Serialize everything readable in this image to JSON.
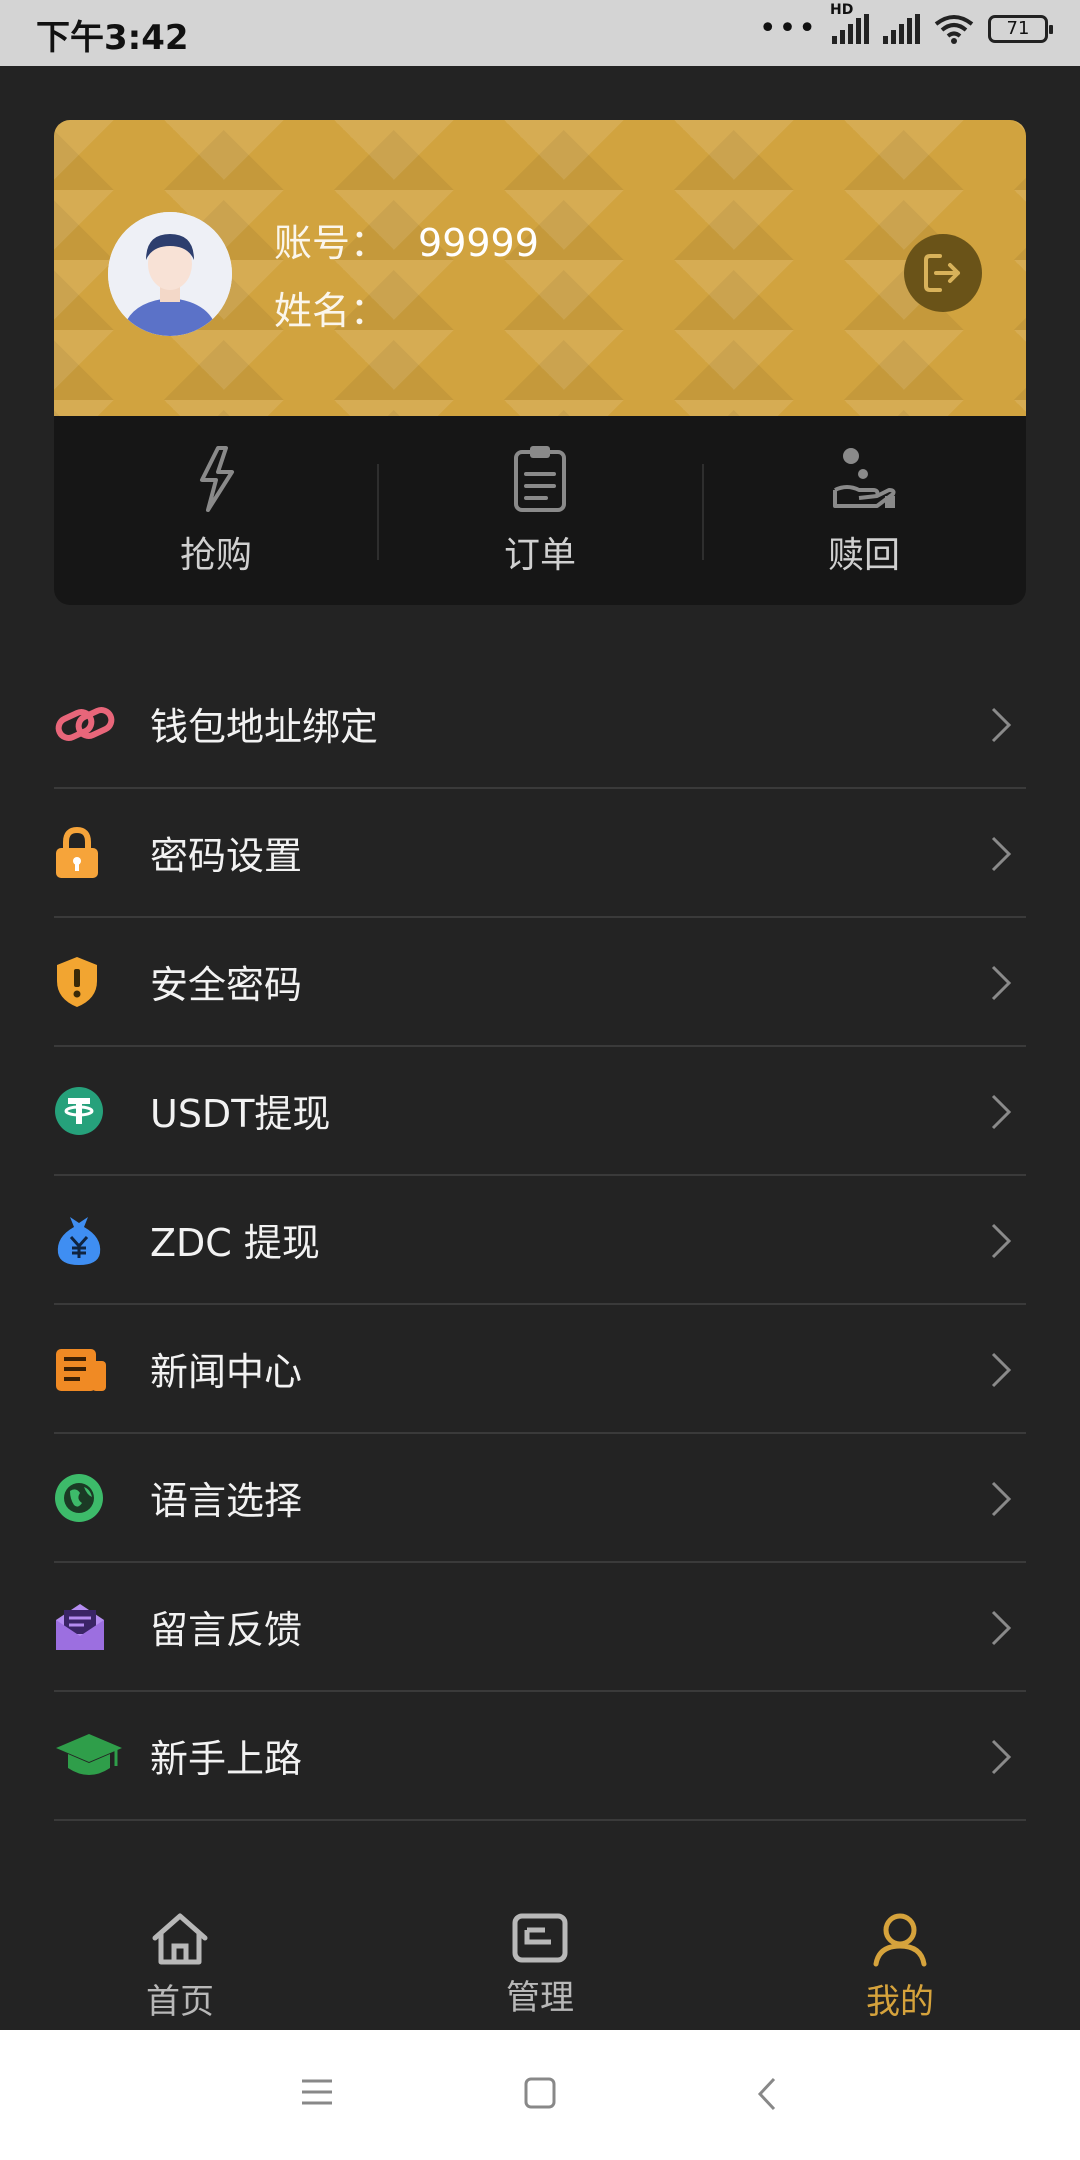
{
  "status_bar": {
    "time": "下午3:42",
    "hd": "HD",
    "battery": "71"
  },
  "profile": {
    "account_label": "账号：",
    "account_value": "99999",
    "name_label": "姓名：",
    "name_value": ""
  },
  "quick_actions": [
    {
      "label": "抢购",
      "icon": "lightning-icon"
    },
    {
      "label": "订单",
      "icon": "clipboard-icon"
    },
    {
      "label": "赎回",
      "icon": "hand-coin-icon"
    }
  ],
  "menu": [
    {
      "label": "钱包地址绑定",
      "icon": "link-icon",
      "color": "#e8667a"
    },
    {
      "label": "密码设置",
      "icon": "lock-icon",
      "color": "#f6a43a"
    },
    {
      "label": "安全密码",
      "icon": "shield-icon",
      "color": "#f2a531"
    },
    {
      "label": "USDT提现",
      "icon": "tether-icon",
      "color": "#26a17b"
    },
    {
      "label": "ZDC 提现",
      "icon": "money-bag-icon",
      "color": "#3f8ef2"
    },
    {
      "label": "新闻中心",
      "icon": "newspaper-icon",
      "color": "#f08a24"
    },
    {
      "label": "语言选择",
      "icon": "globe-icon",
      "color": "#3dbb6a"
    },
    {
      "label": "留言反馈",
      "icon": "message-icon",
      "color": "#9c6fe0"
    },
    {
      "label": "新手上路",
      "icon": "graduation-cap-icon",
      "color": "#2f9e4a"
    }
  ],
  "tabbar": [
    {
      "label": "首页",
      "icon": "home-icon"
    },
    {
      "label": "管理",
      "icon": "wallet-icon"
    },
    {
      "label": "我的",
      "icon": "user-icon",
      "active": true
    }
  ],
  "colors": {
    "accent": "#d6a33c",
    "background": "#232323",
    "card_gold": "#d1a33f"
  }
}
